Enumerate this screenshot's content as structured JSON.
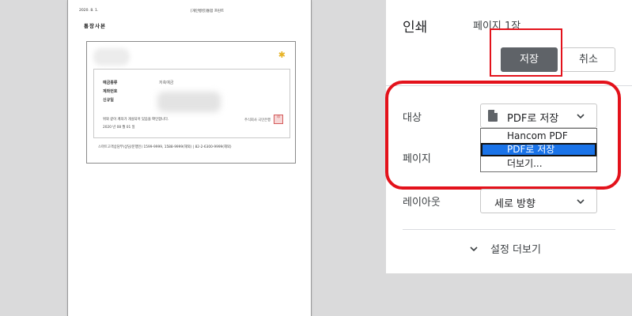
{
  "preview": {
    "header_date": "2020. 8. 1.",
    "header_center": "[개인뱅킹]통합 프린트",
    "doc_title": "통장사본",
    "rows": [
      {
        "label": "예금종류",
        "value": "저축예금"
      },
      {
        "label": "계좌번호",
        "value": ""
      },
      {
        "label": "신규일",
        "value": ""
      }
    ],
    "note": "위와 같이 계좌가 개설되어 있음을 확인합니다.",
    "issue_date": "2020 년 08 월 01 일",
    "bank_name": "주식회사 국민은행",
    "footer": "스마트고객상담부(상담/문행인) 1599-9999, 1588-9999(해외) | 82-2-6300-9999(해외)"
  },
  "panel": {
    "title": "인쇄",
    "page_count": "페이지 1장",
    "save_label": "저장",
    "cancel_label": "취소",
    "destination": {
      "label": "대상",
      "selected": "PDF로 저장",
      "options": [
        "Hancom PDF",
        "PDF로 저장",
        "더보기..."
      ],
      "highlighted_option": "PDF로 저장"
    },
    "pages_label": "페이지",
    "layout": {
      "label": "레이아웃",
      "selected": "세로 방향"
    },
    "more_settings": "설정 더보기"
  },
  "colors": {
    "highlight_red": "#e3121b",
    "save_button": "#5f6368",
    "selected_option": "#1a73e8",
    "preview_bg": "#dadadb"
  }
}
